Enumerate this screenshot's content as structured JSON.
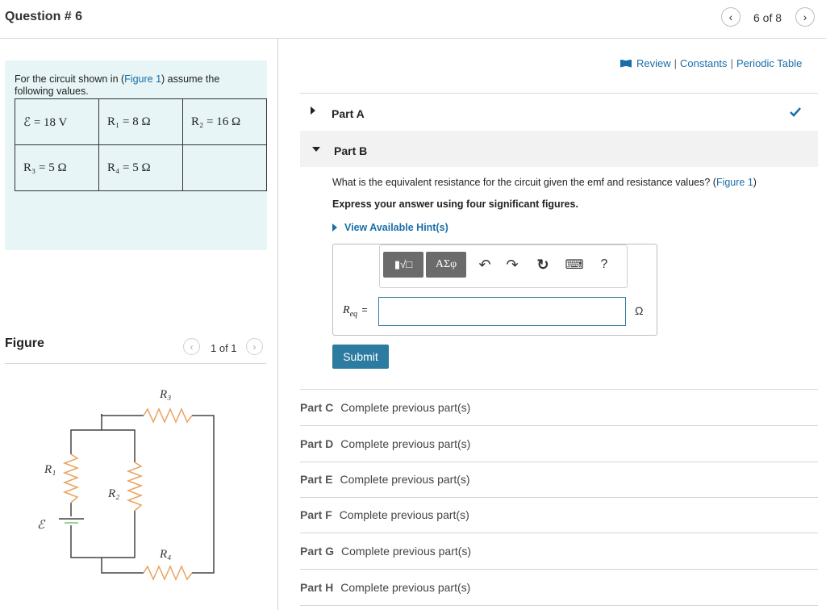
{
  "header": {
    "title": "Question # 6",
    "counter": "6 of 8",
    "prev_icon": "chevron-left-icon",
    "next_icon": "chevron-right-icon"
  },
  "problem": {
    "intro_before": "For the circuit shown in (",
    "figure_link": "Figure 1",
    "intro_after": ") assume the following values.",
    "values": [
      [
        "ℰ = 18 V",
        "R₁ = 8 Ω",
        "R₂ = 16 Ω"
      ],
      [
        "R₃ = 5 Ω",
        "R₄ = 5 Ω",
        ""
      ]
    ]
  },
  "figure": {
    "title": "Figure",
    "counter": "1 of 1",
    "labels": {
      "r1": "R₁",
      "r2": "R₂",
      "r3": "R₃",
      "r4": "R₄",
      "emf": "ℰ"
    }
  },
  "toplinks": {
    "icon": "book-icon",
    "review": "Review",
    "sep1": "|",
    "constants": "Constants",
    "sep2": "|",
    "periodic": "Periodic Table"
  },
  "partA": {
    "label": "Part A",
    "status_icon": "checkmark-icon"
  },
  "partB": {
    "label": "Part B",
    "question_before": "What is the equivalent resistance for the circuit given the emf and resistance values? (",
    "figure_link": "Figure 1",
    "question_after": ")",
    "instruction": "Express your answer using four significant figures.",
    "hint": "View Available Hint(s)",
    "toolbar": {
      "template_label": "▮√□",
      "greek_label": "ΑΣφ",
      "undo": "↶",
      "redo": "↷",
      "reset": "↻",
      "keyboard": "⌨",
      "help": "?"
    },
    "answer_label": "R",
    "answer_sub": "eq",
    "answer_eq": "=",
    "answer_value": "",
    "unit": "Ω",
    "submit": "Submit"
  },
  "other_parts": [
    {
      "label": "Part C",
      "text": "Complete previous part(s)"
    },
    {
      "label": "Part D",
      "text": "Complete previous part(s)"
    },
    {
      "label": "Part E",
      "text": "Complete previous part(s)"
    },
    {
      "label": "Part F",
      "text": "Complete previous part(s)"
    },
    {
      "label": "Part G",
      "text": "Complete previous part(s)"
    },
    {
      "label": "Part H",
      "text": "Complete previous part(s)"
    }
  ],
  "colors": {
    "link": "#1a6ea8",
    "panel_bg": "#e7f5f6",
    "submit_bg": "#2c7ba1",
    "check": "#1d6fa5",
    "resistor": "#e9a35f"
  }
}
